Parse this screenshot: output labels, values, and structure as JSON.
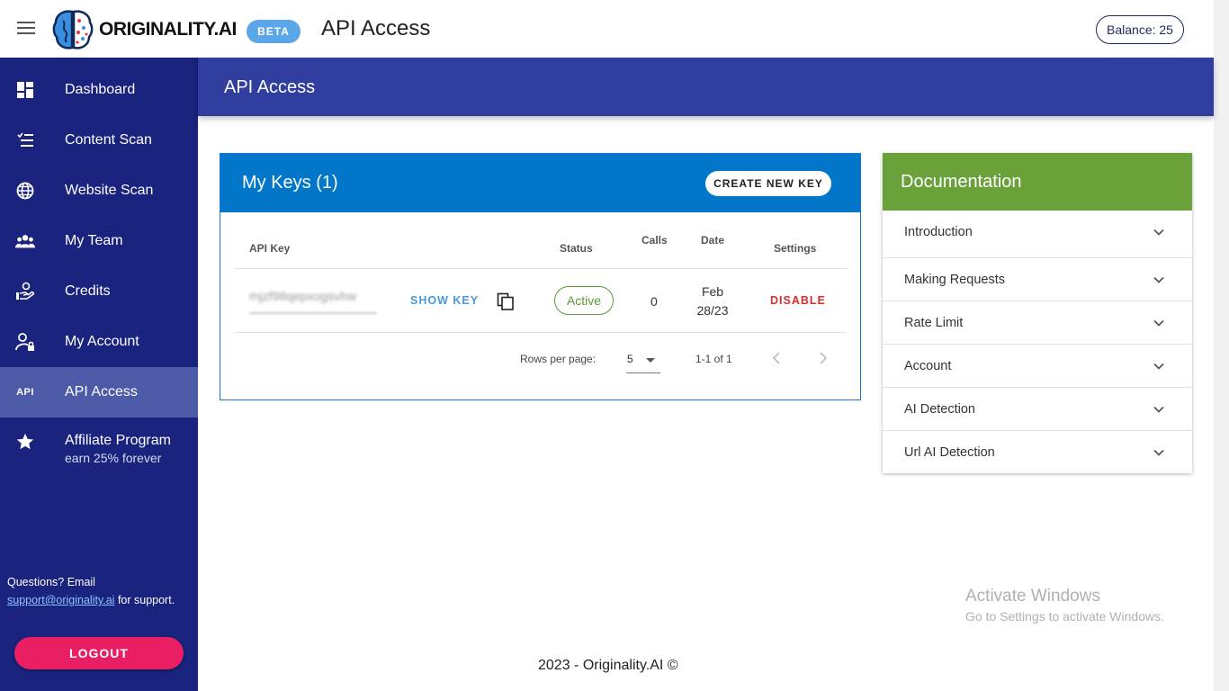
{
  "header": {
    "brand": "ORIGINALITY.AI",
    "beta": "BETA",
    "title": "API Access",
    "balance": "Balance: 25"
  },
  "sidebar": {
    "items": [
      {
        "label": "Dashboard",
        "icon": "dashboard-icon"
      },
      {
        "label": "Content Scan",
        "icon": "checklist-icon"
      },
      {
        "label": "Website Scan",
        "icon": "globe-icon"
      },
      {
        "label": "My Team",
        "icon": "team-icon"
      },
      {
        "label": "Credits",
        "icon": "credits-hand-icon"
      },
      {
        "label": "My Account",
        "icon": "account-lock-icon"
      },
      {
        "label": "API Access",
        "icon": "api-icon",
        "icon_text": "API",
        "active": true
      },
      {
        "label": "Affiliate Program",
        "sub": "earn 25% forever",
        "icon": "star-icon"
      }
    ],
    "support_prefix": "Questions? Email",
    "support_email": "support@originality.ai",
    "support_suffix": " for support.",
    "logout": "LOGOUT"
  },
  "band": {
    "title": "API Access"
  },
  "keys": {
    "title": "My Keys (1)",
    "create_button": "CREATE NEW KEY",
    "columns": {
      "api_key": "API Key",
      "status": "Status",
      "calls": "Calls",
      "date": "Date",
      "settings": "Settings"
    },
    "rows": [
      {
        "key_masked": "mjzf98qepxogsvhw",
        "show_key": "SHOW KEY",
        "status": "Active",
        "calls": "0",
        "date_line1": "Feb",
        "date_line2": "28/23",
        "action": "DISABLE"
      }
    ],
    "pagination": {
      "rows_per_page_label": "Rows per page:",
      "rows_per_page": "5",
      "range": "1-1 of 1"
    }
  },
  "documentation": {
    "title": "Documentation",
    "items": [
      "Introduction",
      "Making Requests",
      "Rate Limit",
      "Account",
      "AI Detection",
      "Url AI Detection"
    ]
  },
  "watermark": {
    "line1": "Activate Windows",
    "line2": "Go to Settings to activate Windows."
  },
  "footer": "2023 - Originality.AI ©",
  "colors": {
    "sidebar": "#1a237e",
    "sidebar_active": "#4d5aa8",
    "band": "#303f9f",
    "keys_header": "#0277c9",
    "doc_header": "#6aa13a",
    "logout": "#e91e63",
    "beta": "#5ba6e8",
    "active_status": "#5a9a3a",
    "disable": "#d32f2f"
  }
}
